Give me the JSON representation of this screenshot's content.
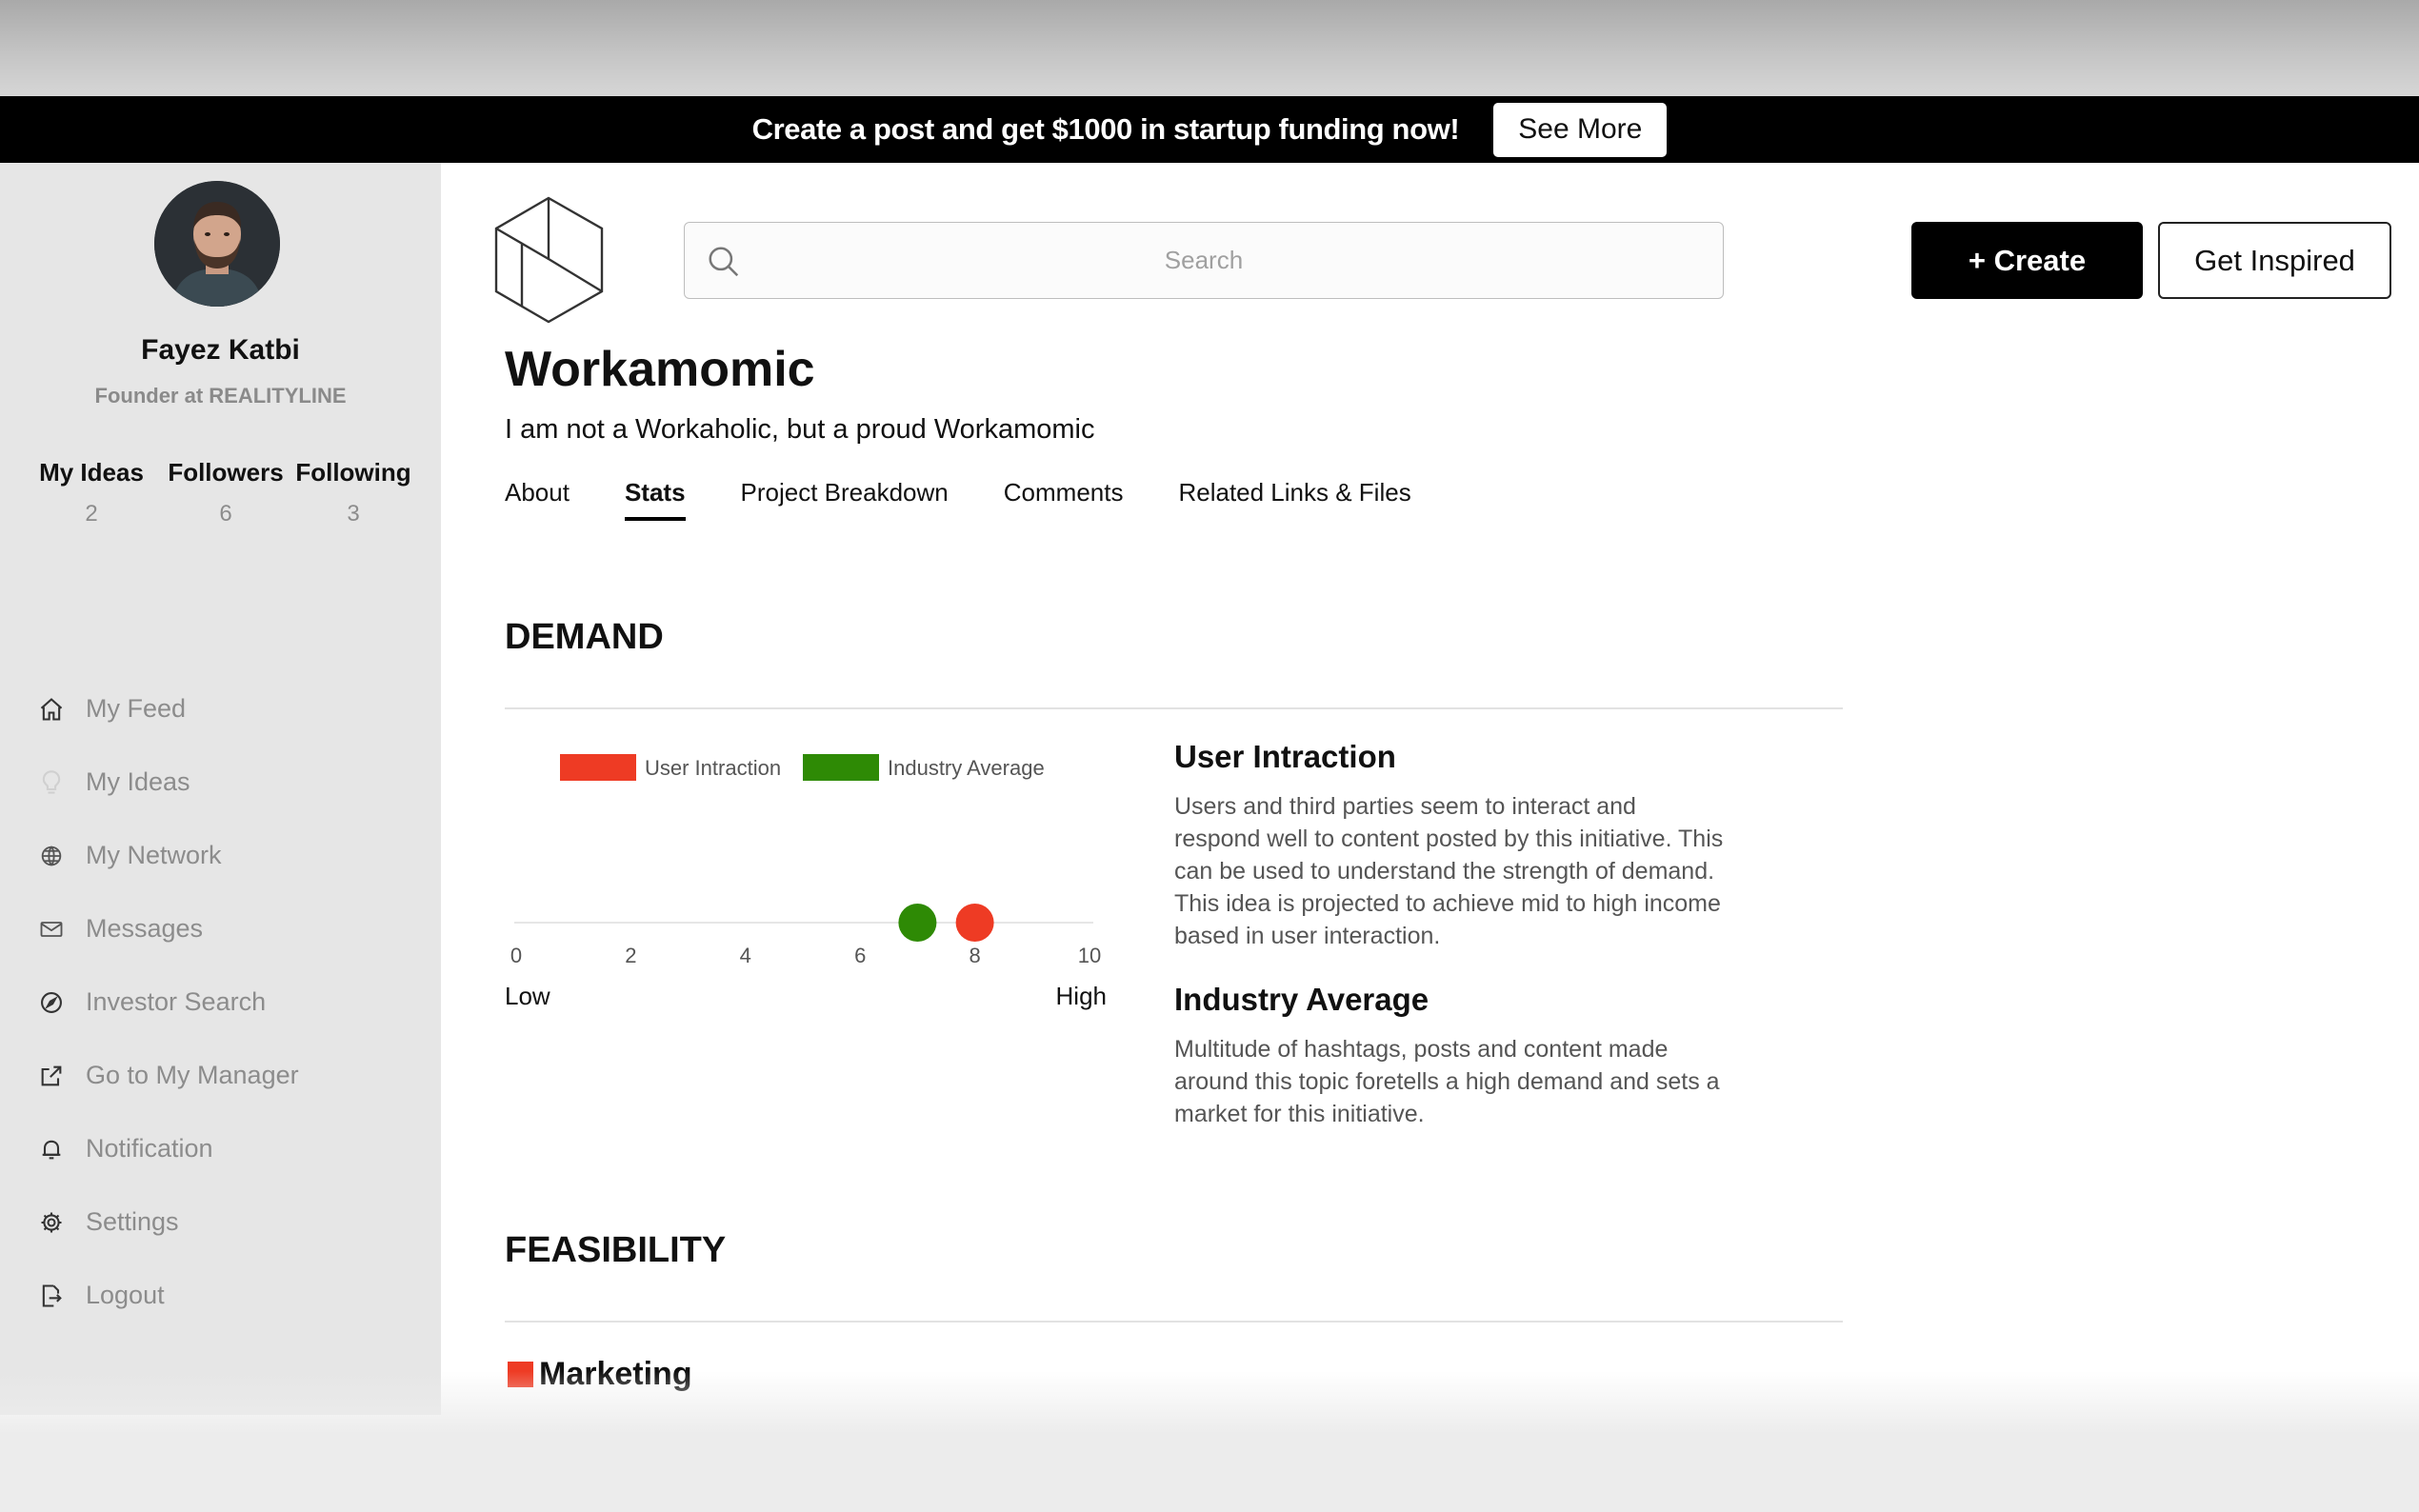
{
  "banner": {
    "text": "Create a post and get $1000 in startup funding now!",
    "button_label": "See More"
  },
  "profile": {
    "name": "Fayez Katbi",
    "role": "Founder at REALITYLINE",
    "stats": [
      {
        "label": "My Ideas",
        "value": "2"
      },
      {
        "label": "Followers",
        "value": "6"
      },
      {
        "label": "Following",
        "value": "3"
      }
    ]
  },
  "nav": {
    "items": [
      {
        "label": "My Feed",
        "icon": "home-icon"
      },
      {
        "label": "My Ideas",
        "icon": "lightbulb-icon"
      },
      {
        "label": "My Network",
        "icon": "globe-icon"
      },
      {
        "label": "Messages",
        "icon": "envelope-icon"
      },
      {
        "label": "Investor Search",
        "icon": "compass-icon"
      },
      {
        "label": "Go to My Manager",
        "icon": "external-link-icon"
      },
      {
        "label": "Notification",
        "icon": "bell-icon"
      },
      {
        "label": "Settings",
        "icon": "gear-icon"
      },
      {
        "label": "Logout",
        "icon": "logout-icon"
      }
    ]
  },
  "header": {
    "search_placeholder": "Search",
    "create_label": "+ Create",
    "inspired_label": "Get Inspired"
  },
  "idea": {
    "title": "Workamomic",
    "tagline": "I am not a Workaholic, but a proud Workamomic"
  },
  "tabs": [
    {
      "label": "About",
      "active": false
    },
    {
      "label": "Stats",
      "active": true
    },
    {
      "label": "Project Breakdown",
      "active": false
    },
    {
      "label": "Comments",
      "active": false
    },
    {
      "label": "Related Links & Files",
      "active": false
    }
  ],
  "demand": {
    "title": "DEMAND",
    "user_interaction": {
      "title": "User Intraction",
      "text": "Users and third parties seem to interact and respond well to content posted by this initiative. This can be used to understand the strength of demand. This idea is projected to achieve mid to high income based in user interaction."
    },
    "industry_average": {
      "title": "Industry Average",
      "text": "Multitude of hashtags, posts and content made around this topic foretells a high demand and sets a market for this initiative."
    }
  },
  "chart_data": {
    "type": "scatter",
    "x_range": [
      0,
      10
    ],
    "ticks": [
      "0",
      "2",
      "4",
      "6",
      "8",
      "10"
    ],
    "low_label": "Low",
    "high_label": "High",
    "series": [
      {
        "name": "User Intraction",
        "value": 8,
        "color": "#ee3b24"
      },
      {
        "name": "Industry Average",
        "value": 7,
        "color": "#2e8a05"
      }
    ]
  },
  "feasibility": {
    "title": "FEASIBILITY",
    "items": [
      {
        "label": "Marketing",
        "color": "#ee3b24"
      }
    ]
  },
  "colors": {
    "accent": "#000000",
    "sidebar_bg": "#e6e6e6",
    "user_interaction": "#ee3b24",
    "industry_average": "#2e8a05"
  }
}
